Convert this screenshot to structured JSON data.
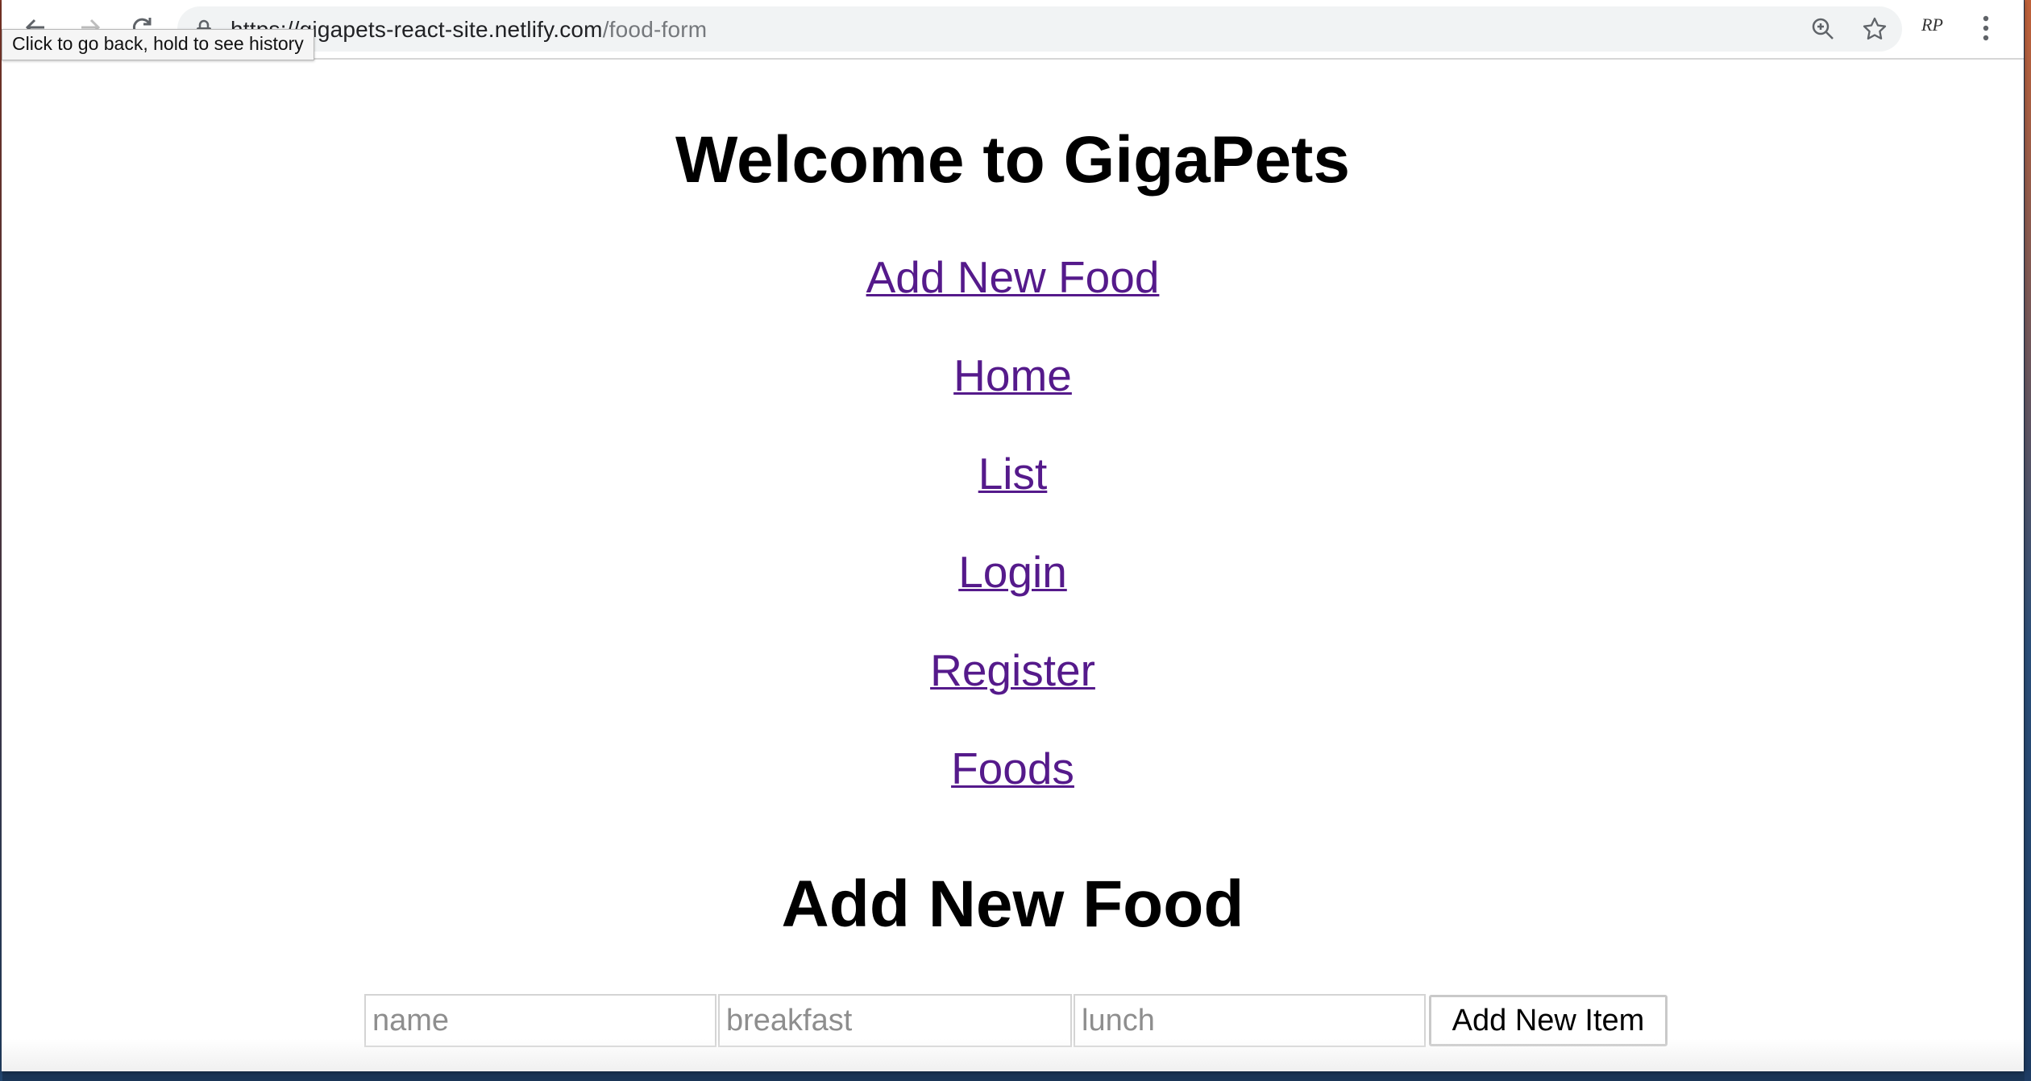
{
  "browser": {
    "url_host": "https://gigapets-react-site.netlify.com",
    "url_path": "/food-form",
    "profile_initials": "RP",
    "tooltip": "Click to go back, hold to see history"
  },
  "page": {
    "title": "Welcome to GigaPets",
    "nav_links": [
      {
        "label": "Add New Food"
      },
      {
        "label": "Home"
      },
      {
        "label": "List"
      },
      {
        "label": "Login"
      },
      {
        "label": "Register"
      },
      {
        "label": "Foods"
      }
    ],
    "form": {
      "heading": "Add New Food",
      "name_placeholder": "name",
      "breakfast_placeholder": "breakfast",
      "lunch_placeholder": "lunch",
      "submit_label": "Add New Item"
    }
  }
}
